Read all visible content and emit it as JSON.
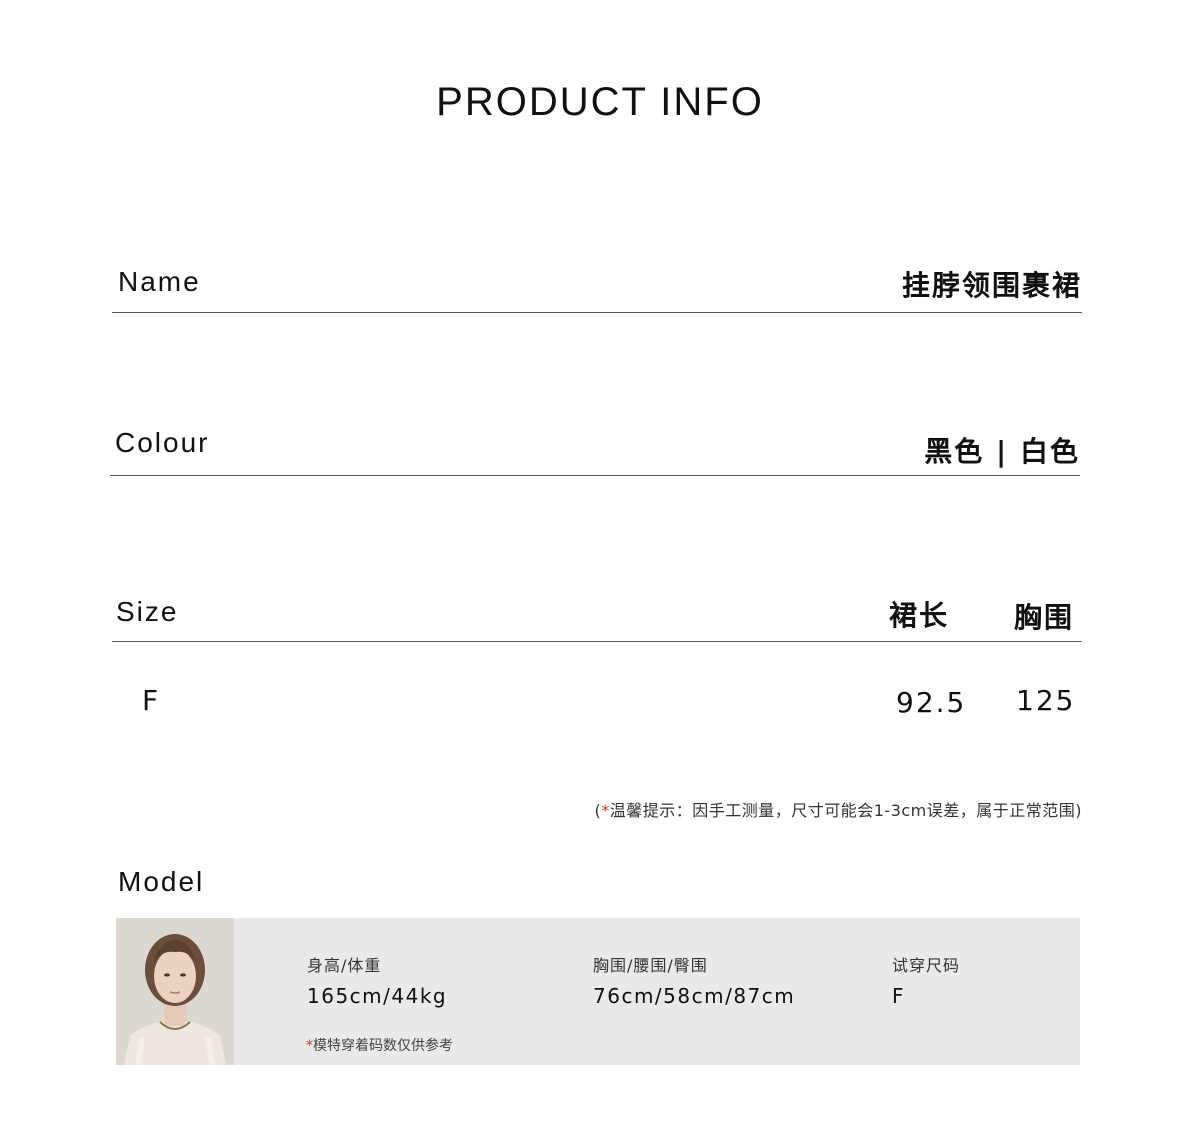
{
  "header": {
    "title": "PRODUCT INFO"
  },
  "name_row": {
    "label": "Name",
    "value": "挂脖领围裹裙"
  },
  "colour_row": {
    "label": "Colour",
    "value": "黑色 | 白色"
  },
  "size_table": {
    "label": "Size",
    "columns": [
      "裙长",
      "胸围"
    ],
    "rows": [
      {
        "size": "F",
        "values": [
          "92.5",
          "125"
        ]
      }
    ]
  },
  "size_note": {
    "open": "(",
    "star": "*",
    "text": "温馨提示：因手工测量，尺寸可能会1-3cm误差，属于正常范围)"
  },
  "model": {
    "heading": "Model",
    "height_weight_label": "身高/体重",
    "height_weight_value": "165cm/44kg",
    "measurements_label": "胸围/腰围/臀围",
    "measurements_value": "76cm/58cm/87cm",
    "tried_size_label": "试穿尺码",
    "tried_size_value": "F",
    "note_star": "*",
    "note_text": "模特穿着码数仅供参考"
  }
}
